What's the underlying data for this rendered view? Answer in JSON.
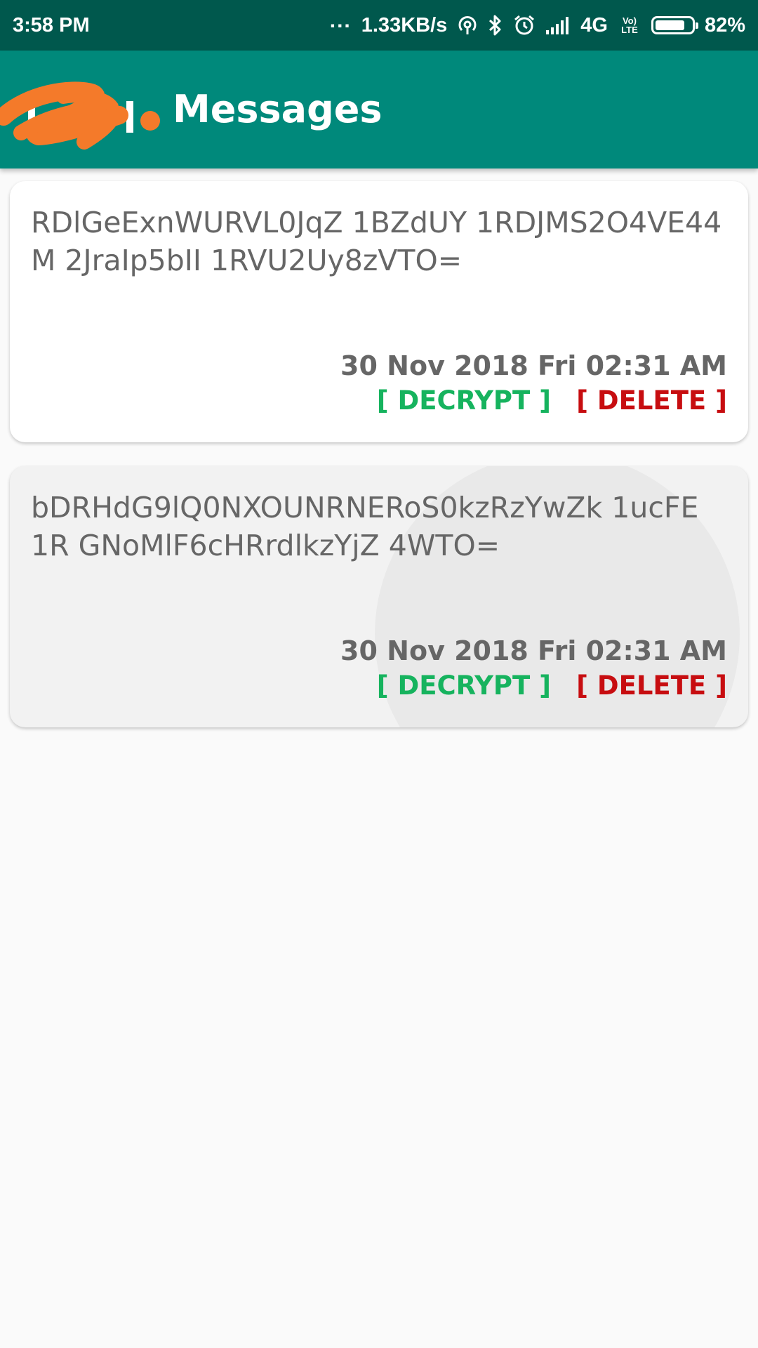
{
  "status_bar": {
    "time": "3:58 PM",
    "more_dots": "...",
    "speed": "1.33KB/s",
    "network": "4G",
    "volte": "Vo) LTE",
    "battery_level": 0.82,
    "battery_text": "82%"
  },
  "app_bar": {
    "title": "Messages"
  },
  "messages": [
    {
      "text": "RDlGeExnWURVL0JqZ 1BZdUY 1RDJMS2O4VE44M 2JraIp5bII 1RVU2Uy8zVTO=",
      "date": "30 Nov 2018 Fri 02:31 AM",
      "decrypt_label": "[ DECRYPT ]",
      "delete_label": "[ DELETE ]"
    },
    {
      "text": "bDRHdG9lQ0NXOUNRNERoS0kzRzYwZk 1ucFE 1R GNoMlF6cHRrdlkzYjZ 4WTO=",
      "date": "30 Nov 2018 Fri 02:31 AM",
      "decrypt_label": "[ DECRYPT ]",
      "delete_label": "[ DELETE ]"
    }
  ],
  "colors": {
    "status_bar": "#00584d",
    "app_bar": "#00897b",
    "decrypt": "#16b35e",
    "delete": "#c70d10",
    "scribble": "#f47a2a"
  }
}
